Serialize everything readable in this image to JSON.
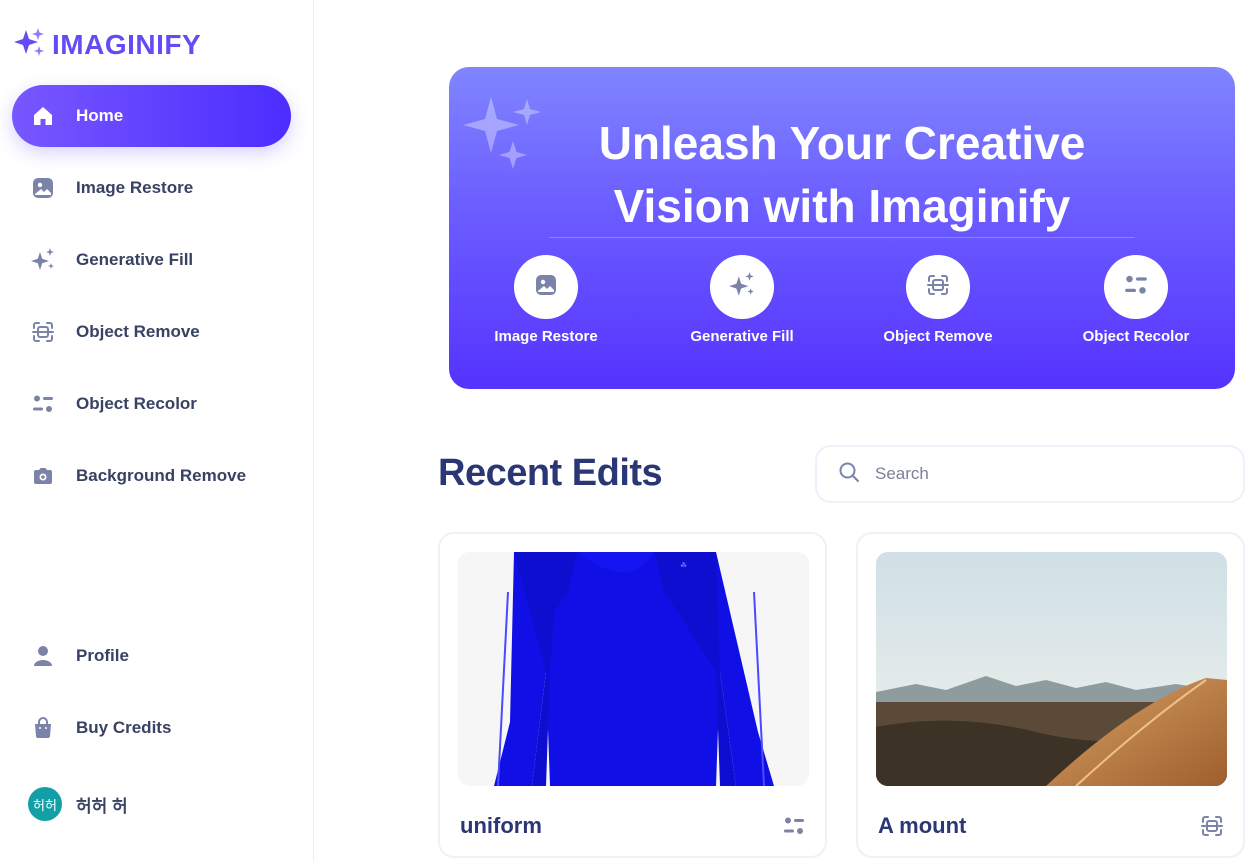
{
  "app": {
    "logo_text": "IMAGINIFY"
  },
  "sidebar": {
    "items": [
      {
        "label": "Home",
        "icon": "home-icon",
        "active": true
      },
      {
        "label": "Image Restore",
        "icon": "image-icon"
      },
      {
        "label": "Generative Fill",
        "icon": "stars-icon"
      },
      {
        "label": "Object Remove",
        "icon": "scan-icon"
      },
      {
        "label": "Object Recolor",
        "icon": "filter-icon"
      },
      {
        "label": "Background Remove",
        "icon": "camera-icon"
      }
    ],
    "bottom": [
      {
        "label": "Profile",
        "icon": "profile-icon"
      },
      {
        "label": "Buy Credits",
        "icon": "bag-icon"
      }
    ],
    "user": {
      "avatar_text": "허허",
      "name": "허허 허"
    }
  },
  "banner": {
    "title_line1": "Unleash Your Creative",
    "title_line2": "Vision with Imaginify",
    "links": [
      {
        "label": "Image Restore",
        "icon": "image-icon"
      },
      {
        "label": "Generative Fill",
        "icon": "stars-icon"
      },
      {
        "label": "Object Remove",
        "icon": "scan-icon"
      },
      {
        "label": "Object Recolor",
        "icon": "filter-icon"
      }
    ]
  },
  "recent": {
    "title": "Recent Edits",
    "search_placeholder": "Search",
    "cards": [
      {
        "title": "uniform",
        "type_icon": "filter-icon",
        "image": "blue long-sleeve dress"
      },
      {
        "title": "A mount",
        "type_icon": "scan-icon",
        "image": "desert dunes with mountains"
      }
    ]
  },
  "colors": {
    "primary": "#624cf5",
    "heading": "#2b3674",
    "text": "#384262",
    "icon": "#7b84a8"
  }
}
